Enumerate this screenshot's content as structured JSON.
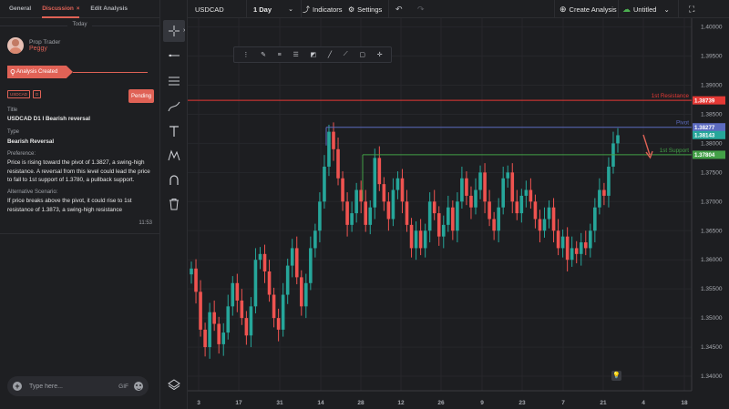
{
  "left_panel": {
    "tabs": [
      {
        "label": "General"
      },
      {
        "label": "Discussion",
        "close": "×"
      },
      {
        "label": "Edit Analysis"
      }
    ],
    "date_separator": "Today",
    "author": {
      "role": "Prop Trader",
      "name": "Peggy"
    },
    "status": "Analysis Created",
    "chips": [
      "USDCAD",
      "D"
    ],
    "pending_label": "Pending",
    "fields": {
      "title_label": "Title",
      "title_value": "USDCAD D1 I Bearish reversal",
      "type_label": "Type",
      "type_value": "Bearish Reversal",
      "preference_label": "Preference:",
      "preference_value": "Price is rising toward the pivot of 1.3827, a swing-high resistance. A reversal from this level could lead the price to fall to 1st support of 1.3780, a pullback support.",
      "alternative_label": "Alternative Scenario:",
      "alternative_value": "If price breaks above the pivot, it could rise to 1st resistance of 1.3873, a swing-high resistance"
    },
    "message_time": "11:53",
    "chat_input": {
      "placeholder": "Type here...",
      "gif_label": "GIF"
    }
  },
  "toolbar": {
    "tools": [
      "crosshair-icon",
      "horizontal-line-icon",
      "channel-icon",
      "brush-icon",
      "text-icon",
      "pattern-icon",
      "magnet-icon",
      "trash-icon",
      "layers-icon"
    ]
  },
  "topbar": {
    "symbol": "USDCAD",
    "timeframe": "1 Day",
    "indicators_label": "Indicators",
    "settings_label": "Settings",
    "create_analysis_label": "Create Analysis",
    "layout_name": "Untitled"
  },
  "colors": {
    "accent": "#e06256",
    "bull": "#26a69a",
    "bear": "#ef5350",
    "resistance": "#e53935",
    "pivot": "#5c6bc0",
    "support": "#43a047"
  },
  "chart_data": {
    "type": "candlestick",
    "symbol": "USDCAD",
    "timeframe": "1 Day",
    "ylim": [
      1.3375,
      1.4015
    ],
    "y_ticks": [
      "1.40000",
      "1.39500",
      "1.39000",
      "1.38500",
      "1.38000",
      "1.37500",
      "1.37000",
      "1.36500",
      "1.36000",
      "1.35500",
      "1.35000",
      "1.34500",
      "1.34000"
    ],
    "x_ticks": [
      "3",
      "17",
      "31",
      "14",
      "28",
      "12",
      "26",
      "9",
      "23",
      "7",
      "21",
      "4",
      "18"
    ],
    "levels": [
      {
        "name": "1st Resistance",
        "value": 1.38739,
        "value_label": "1.38739",
        "color": "#e53935"
      },
      {
        "name": "Pivot",
        "value": 1.38277,
        "value_label": "1.38277",
        "color": "#5c6bc0"
      },
      {
        "name": "1st Support",
        "value": 1.37804,
        "value_label": "1.37804",
        "color": "#43a047"
      }
    ],
    "current_price": {
      "value": 1.38143,
      "label": "1.38143"
    },
    "close_approx": [
      1.3585,
      1.3545,
      1.348,
      1.345,
      1.351,
      1.349,
      1.3455,
      1.3475,
      1.352,
      1.356,
      1.353,
      1.35,
      1.347,
      1.352,
      1.36,
      1.361,
      1.358,
      1.354,
      1.35,
      1.348,
      1.354,
      1.359,
      1.362,
      1.357,
      1.352,
      1.356,
      1.362,
      1.365,
      1.37,
      1.376,
      1.382,
      1.379,
      1.374,
      1.37,
      1.366,
      1.368,
      1.372,
      1.37,
      1.366,
      1.369,
      1.3775,
      1.373,
      1.37,
      1.367,
      1.372,
      1.374,
      1.37,
      1.366,
      1.362,
      1.365,
      1.362,
      1.365,
      1.37,
      1.368,
      1.364,
      1.366,
      1.369,
      1.365,
      1.37,
      1.374,
      1.371,
      1.369,
      1.372,
      1.375,
      1.37,
      1.367,
      1.365,
      1.369,
      1.374,
      1.375,
      1.37,
      1.368,
      1.371,
      1.372,
      1.37,
      1.367,
      1.365,
      1.367,
      1.369,
      1.365,
      1.362,
      1.364,
      1.36,
      1.362,
      1.361,
      1.363,
      1.362,
      1.365,
      1.369,
      1.372,
      1.371,
      1.376,
      1.38,
      1.3814
    ]
  }
}
